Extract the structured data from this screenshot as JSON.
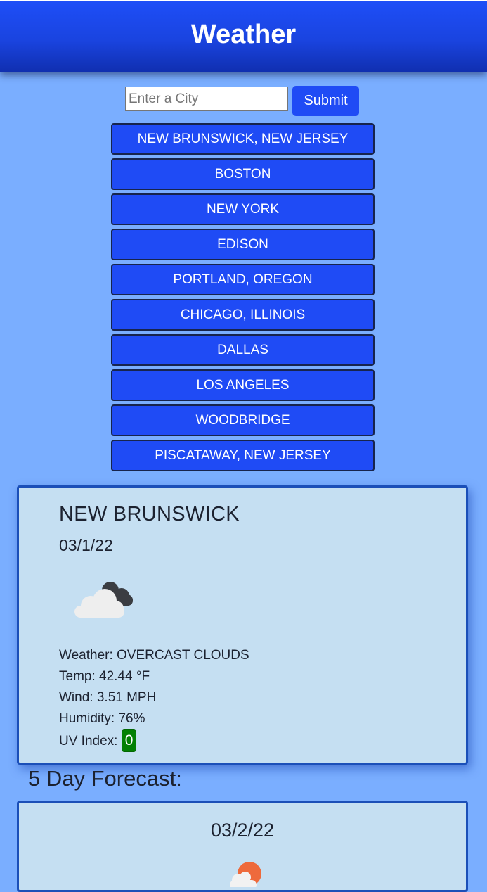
{
  "header": {
    "title": "Weather"
  },
  "search": {
    "placeholder": "Enter a City",
    "value": "",
    "submit_label": "Submit"
  },
  "history": [
    "NEW BRUNSWICK, NEW JERSEY",
    "BOSTON",
    "NEW YORK",
    "EDISON",
    "PORTLAND, OREGON",
    "CHICAGO, ILLINOIS",
    "DALLAS",
    "LOS ANGELES",
    "WOODBRIDGE",
    "PISCATAWAY, NEW JERSEY"
  ],
  "current": {
    "city": "NEW BRUNSWICK",
    "date": "03/1/22",
    "icon": "overcast-clouds-icon",
    "weather": "Weather: OVERCAST CLOUDS",
    "temp": "Temp: 42.44 °F",
    "wind": "Wind: 3.51 MPH",
    "humidity": "Humidity: 76%",
    "uv_label": "UV Index:",
    "uv_value": "0",
    "uv_color": "#038004"
  },
  "forecast": {
    "title": "5 Day Forecast:",
    "days": [
      {
        "date": "03/2/22",
        "icon": "sun-behind-cloud-icon"
      }
    ]
  },
  "colors": {
    "background": "#7aaeff",
    "header": "#1a44e0",
    "button": "#1f4bf5",
    "card": "#c5dff2",
    "card_border": "#1b4fb8"
  }
}
